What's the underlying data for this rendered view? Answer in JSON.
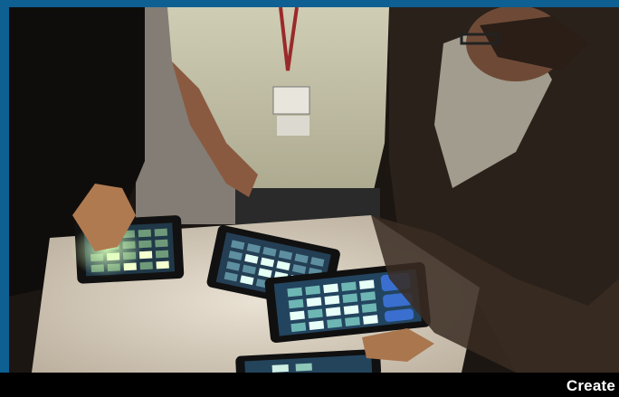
{
  "caption": {
    "text": "Create"
  },
  "colors": {
    "frame": "#0e5f92",
    "caption_bg": "#000000",
    "caption_text": "#ffffff",
    "pad_glow": "#9fe6d2"
  }
}
